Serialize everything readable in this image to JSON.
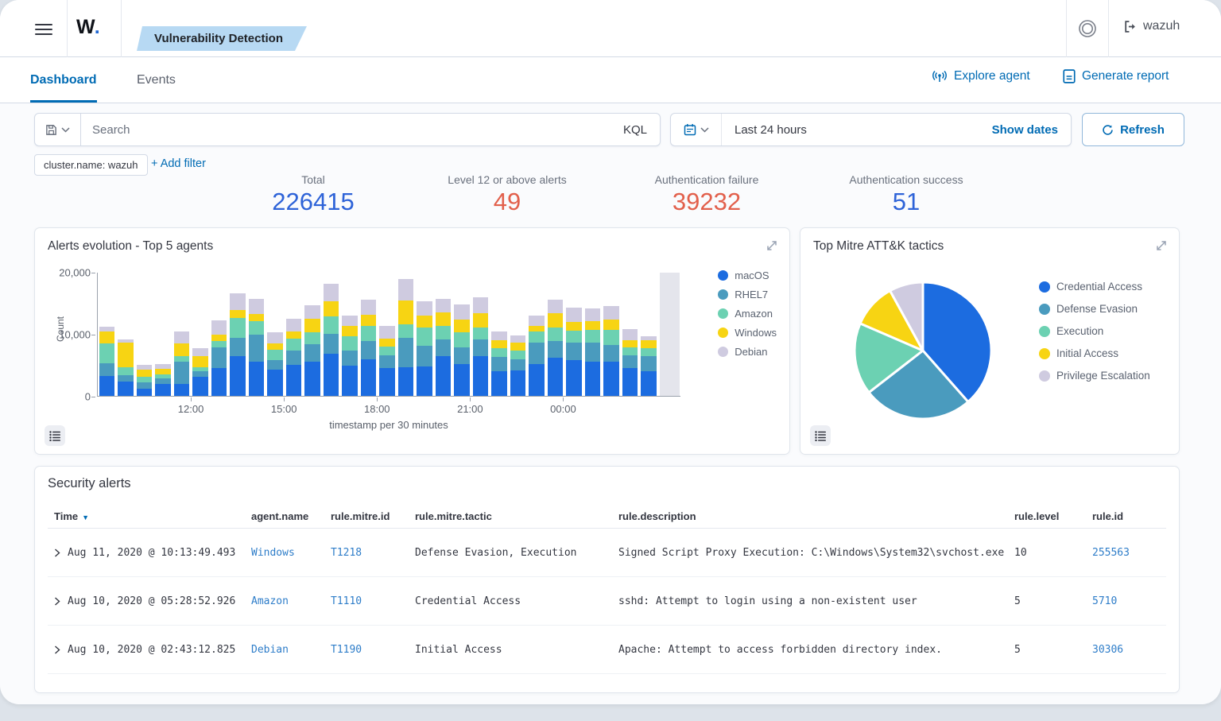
{
  "header": {
    "logo_w": "W",
    "logo_dot": ".",
    "breadcrumb": "Vulnerability Detection",
    "username": "wazuh"
  },
  "tabs": [
    {
      "label": "Dashboard",
      "active": true
    },
    {
      "label": "Events",
      "active": false
    }
  ],
  "actions": {
    "explore_agent": "Explore agent",
    "generate_report": "Generate report"
  },
  "toolbar": {
    "search_placeholder": "Search",
    "kql_label": "KQL",
    "time_range": "Last 24 hours",
    "show_dates": "Show dates",
    "refresh": "Refresh"
  },
  "filters": {
    "chip": "cluster.name: wazuh",
    "add_filter": "+ Add filter"
  },
  "stats": [
    {
      "label": "Total",
      "value": "226415",
      "color": "#2e63d8"
    },
    {
      "label": "Level 12 or above alerts",
      "value": "49",
      "color": "#e2604c"
    },
    {
      "label": "Authentication failure",
      "value": "39232",
      "color": "#e2604c"
    },
    {
      "label": "Authentication success",
      "value": "51",
      "color": "#2e63d8"
    }
  ],
  "stat_positions": [
    394,
    638,
    889,
    1140
  ],
  "chart_data": [
    {
      "type": "bar",
      "stacked": true,
      "title": "Alerts evolution - Top 5 agents",
      "xlabel": "timestamp per 30 minutes",
      "ylabel": "Count",
      "ylim": [
        0,
        20000
      ],
      "grid": false,
      "legend_position": "right",
      "yticks": [
        {
          "value": 0,
          "label": "0"
        },
        {
          "value": 10000,
          "label": "10,000"
        },
        {
          "value": 20000,
          "label": "20,000"
        }
      ],
      "xticks": [
        {
          "label": "12:00",
          "boundary": 5
        },
        {
          "label": "15:00",
          "boundary": 10
        },
        {
          "label": "18:00",
          "boundary": 15
        },
        {
          "label": "21:00",
          "boundary": 20
        },
        {
          "label": "00:00",
          "boundary": 25
        }
      ],
      "series": [
        {
          "name": "macOS",
          "color": "#1c6ce0",
          "values": [
            3200,
            2300,
            1200,
            1900,
            2000,
            3100,
            4500,
            6500,
            5500,
            4300,
            5000,
            5600,
            6800,
            4900,
            6000,
            4500,
            4600,
            4800,
            6500,
            5200,
            6500,
            4000,
            4100,
            5200,
            6200,
            5800,
            5600,
            5500,
            4500,
            4000
          ]
        },
        {
          "name": "RHEL7",
          "color": "#4a9bbe",
          "values": [
            2100,
            1100,
            1000,
            900,
            3600,
            900,
            3400,
            2900,
            4400,
            1500,
            2300,
            2800,
            3300,
            2500,
            2900,
            2100,
            4800,
            3300,
            2700,
            2700,
            2600,
            2300,
            1900,
            3400,
            2700,
            2900,
            3000,
            2700,
            2100,
            2500
          ]
        },
        {
          "name": "Amazon",
          "color": "#6cd1b2",
          "values": [
            3200,
            1200,
            900,
            700,
            900,
            600,
            1000,
            3200,
            2200,
            1700,
            2000,
            1900,
            2800,
            2300,
            2400,
            1400,
            2200,
            3000,
            2200,
            2400,
            2000,
            1400,
            1400,
            1800,
            2200,
            1900,
            2100,
            2500,
            1300,
            1300
          ]
        },
        {
          "name": "Windows",
          "color": "#f7d413",
          "values": [
            2000,
            4000,
            1200,
            900,
            2000,
            1900,
            1100,
            1300,
            1200,
            1000,
            1200,
            2200,
            2400,
            1600,
            1900,
            1300,
            3900,
            2000,
            2100,
            2100,
            2300,
            1300,
            1200,
            900,
            2300,
            1400,
            1400,
            1700,
            1100,
            1200
          ]
        },
        {
          "name": "Debian",
          "color": "#cfcbe0",
          "values": [
            700,
            600,
            700,
            800,
            2000,
            1200,
            2300,
            2800,
            2400,
            1800,
            2000,
            2200,
            2900,
            1800,
            2400,
            2000,
            3500,
            2300,
            2200,
            2500,
            2600,
            1500,
            1200,
            1700,
            2200,
            2300,
            2100,
            2200,
            1800,
            700
          ]
        }
      ],
      "partial_bucket": {
        "value": 20000,
        "color": "#e4e5ec"
      }
    },
    {
      "type": "pie",
      "title": "Top Mitre ATT&K tactics",
      "legend_position": "right",
      "slices": [
        {
          "label": "Credential Access",
          "value": 38.5,
          "color": "#1c6ce0"
        },
        {
          "label": "Defense Evasion",
          "value": 26.0,
          "color": "#4a9bbe"
        },
        {
          "label": "Execution",
          "value": 17.0,
          "color": "#6cd1b2"
        },
        {
          "label": "Initial Access",
          "value": 10.5,
          "color": "#f7d413"
        },
        {
          "label": "Privilege Escalation",
          "value": 8.0,
          "color": "#cfcbe0"
        }
      ]
    }
  ],
  "table": {
    "title": "Security alerts",
    "columns": [
      "Time",
      "agent.name",
      "rule.mitre.id",
      "rule.mitre.tactic",
      "rule.description",
      "rule.level",
      "rule.id"
    ],
    "sorted_column": "Time",
    "rows": [
      {
        "time": "Aug 11, 2020 @ 10:13:49.493",
        "agent": "Windows",
        "mitre_id": "T1218",
        "tactic": "Defense Evasion, Execution",
        "description": "Signed Script Proxy Execution: C:\\Windows\\System32\\svchost.exe",
        "level": "10",
        "rule_id": "255563"
      },
      {
        "time": "Aug 10, 2020 @ 05:28:52.926",
        "agent": "Amazon",
        "mitre_id": "T1110",
        "tactic": "Credential Access",
        "description": "sshd: Attempt to login using a non-existent user",
        "level": "5",
        "rule_id": "5710"
      },
      {
        "time": "Aug 10, 2020 @ 02:43:12.825",
        "agent": "Debian",
        "mitre_id": "T1190",
        "tactic": "Initial Access",
        "description": "Apache: Attempt to access forbidden directory index.",
        "level": "5",
        "rule_id": "30306"
      }
    ]
  }
}
